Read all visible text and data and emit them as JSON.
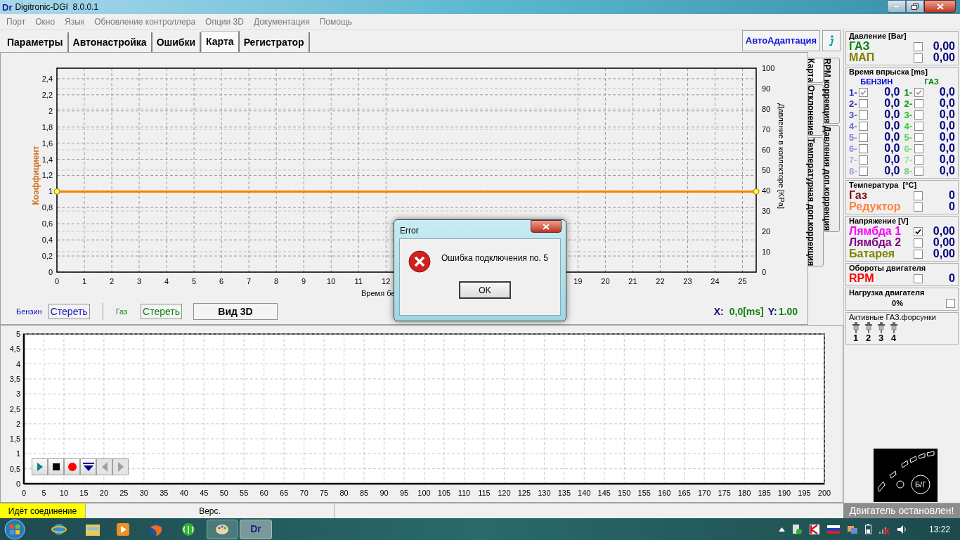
{
  "window": {
    "logo": "Dr",
    "title": "Digitronic-DGI  8.0.0.1"
  },
  "menu": [
    "Порт",
    "Окно",
    "Язык",
    "Обновление контроллера",
    "Опции 3D",
    "Документация",
    "Помощь"
  ],
  "tabs": [
    {
      "label": "Параметры",
      "selected": false
    },
    {
      "label": "Автонастройка",
      "selected": false
    },
    {
      "label": "Ошибки",
      "selected": false
    },
    {
      "label": "Карта",
      "selected": true
    },
    {
      "label": "Регистратор",
      "selected": false
    }
  ],
  "autoadapt_button": "АвтоАдаптация",
  "map": {
    "chart_data": {
      "type": "line",
      "xlabel": "Время бе",
      "ylabel": "Коэффициент",
      "x": [
        0,
        25.5
      ],
      "grid": true,
      "series": [
        {
          "color": "#ff8000",
          "marker": "circle",
          "values": [
            1,
            1
          ]
        }
      ],
      "xlim": [
        0,
        25.5
      ],
      "ylim": [
        0,
        2.53
      ],
      "xticks": [
        0,
        1,
        2,
        3,
        4,
        5,
        6,
        7,
        8,
        9,
        10,
        11,
        12,
        19,
        20,
        21,
        22,
        23,
        24,
        25
      ],
      "yticks": [
        {
          "value": 0,
          "label": "0"
        },
        {
          "value": 0.2,
          "label": "0,2"
        },
        {
          "value": 0.4,
          "label": "0,4"
        },
        {
          "value": 0.6,
          "label": "0,6"
        },
        {
          "value": 0.8,
          "label": "0,8"
        },
        {
          "value": 1,
          "label": "1"
        },
        {
          "value": 1.2,
          "label": "1,2"
        },
        {
          "value": 1.4,
          "label": "1,4"
        },
        {
          "value": 1.6,
          "label": "1,6"
        },
        {
          "value": 1.8,
          "label": "1,8"
        },
        {
          "value": 2,
          "label": "2"
        },
        {
          "value": 2.2,
          "label": "2,2"
        },
        {
          "value": 2.4,
          "label": "2,4"
        }
      ]
    },
    "right_axis": {
      "label": "Давление в коллекторе [KPa]",
      "ticks": [
        "100",
        "90",
        "80",
        "70",
        "60",
        "50",
        "40",
        "30",
        "20",
        "10",
        "0"
      ]
    }
  },
  "side_tabs": {
    "front": [
      {
        "label": "Карта",
        "selected": true
      },
      {
        "label": "Отклонение",
        "selected": false
      },
      {
        "label": "Температурная доп.коррекция",
        "selected": false
      }
    ],
    "back": [
      {
        "label": "RPM коррекция",
        "selected": false
      },
      {
        "label": "Давления доп.коррекция",
        "selected": false
      }
    ]
  },
  "map_controls": {
    "petrol_label": "Бензин",
    "petrol_clear": "Стереть",
    "gas_label": "Газ",
    "gas_clear": "Стереть",
    "view3d": "Вид 3D",
    "x_label": "X:",
    "x_value": "0,0[ms]",
    "y_label": "Y:",
    "y_value": "1.00"
  },
  "recorder": {
    "chart_data": {
      "type": "line",
      "grid": true,
      "xlim": [
        0,
        200
      ],
      "ylim": [
        0,
        5
      ],
      "xticks": [
        0,
        5,
        10,
        15,
        20,
        25,
        30,
        35,
        40,
        45,
        50,
        55,
        60,
        65,
        70,
        75,
        80,
        85,
        90,
        95,
        100,
        105,
        110,
        115,
        120,
        125,
        130,
        135,
        140,
        145,
        150,
        155,
        160,
        165,
        170,
        175,
        180,
        185,
        190,
        195,
        200
      ],
      "yticks": [
        {
          "value": 0,
          "label": "0"
        },
        {
          "value": 0.5,
          "label": "0,5"
        },
        {
          "value": 1,
          "label": "1"
        },
        {
          "value": 1.5,
          "label": "1,5"
        },
        {
          "value": 2,
          "label": "2"
        },
        {
          "value": 2.5,
          "label": "2,5"
        },
        {
          "value": 3,
          "label": "3"
        },
        {
          "value": 3.5,
          "label": "3,5"
        },
        {
          "value": 4,
          "label": "4"
        },
        {
          "value": 4.5,
          "label": "4,5"
        },
        {
          "value": 5,
          "label": "5"
        }
      ]
    },
    "toolbar": [
      {
        "kind": "play",
        "disabled": false
      },
      {
        "kind": "stop",
        "disabled": false
      },
      {
        "kind": "record",
        "disabled": false
      },
      {
        "kind": "down",
        "disabled": false
      },
      {
        "kind": "back",
        "disabled": true
      },
      {
        "kind": "forward",
        "disabled": true
      }
    ]
  },
  "panels": [
    {
      "kind": "rows",
      "title": "Давление [Bar]",
      "rows": [
        {
          "label": "ГАЗ",
          "color": "#108010",
          "checked": false,
          "value": "0,00"
        },
        {
          "label": "МАП",
          "color": "#808000",
          "checked": false,
          "value": "0,00"
        }
      ]
    },
    {
      "kind": "injection",
      "title": "Время впрыска [ms]",
      "columns": [
        {
          "heading": "БЕНЗИН",
          "color": "#0000e0",
          "rows": [
            {
              "label": "1-",
              "color": "#2020c0",
              "checked": true,
              "value": "0,0"
            },
            {
              "label": "2-",
              "color": "#3030c0",
              "checked": false,
              "value": "0,0"
            },
            {
              "label": "3-",
              "color": "#5050c8",
              "checked": false,
              "value": "0,0"
            },
            {
              "label": "4-",
              "color": "#6a6ad0",
              "checked": false,
              "value": "0,0"
            },
            {
              "label": "5-",
              "color": "#8080d8",
              "checked": false,
              "value": "0,0"
            },
            {
              "label": "6-",
              "color": "#9090e0",
              "checked": false,
              "value": "0,0"
            },
            {
              "label": "7-",
              "color": "#b0b0e8",
              "checked": false,
              "value": "0,0"
            },
            {
              "label": "8-",
              "color": "#9c9ce0",
              "checked": false,
              "value": "0,0"
            }
          ]
        },
        {
          "heading": "ГАЗ",
          "color": "#008000",
          "rows": [
            {
              "label": "1-",
              "color": "#008000",
              "checked": true,
              "value": "0,0"
            },
            {
              "label": "2-",
              "color": "#00a000",
              "checked": false,
              "value": "0,0"
            },
            {
              "label": "3-",
              "color": "#20c020",
              "checked": false,
              "value": "0,0"
            },
            {
              "label": "4-",
              "color": "#30d030",
              "checked": false,
              "value": "0,0"
            },
            {
              "label": "5-",
              "color": "#50d850",
              "checked": false,
              "value": "0,0"
            },
            {
              "label": "6-",
              "color": "#70e070",
              "checked": false,
              "value": "0,0"
            },
            {
              "label": "7-",
              "color": "#90e890",
              "checked": false,
              "value": "0,0"
            },
            {
              "label": "8-",
              "color": "#78cc78",
              "checked": false,
              "value": "0,0"
            }
          ]
        }
      ]
    },
    {
      "kind": "rows",
      "title": "Температура  [°C]",
      "rows": [
        {
          "label": "Газ",
          "color": "#800000",
          "checked": false,
          "value": "0"
        },
        {
          "label": "Редуктор",
          "color": "#ff8040",
          "checked": false,
          "value": "0"
        }
      ]
    },
    {
      "kind": "rows",
      "title": "Напряжение [V]",
      "rows": [
        {
          "label": "Лямбда 1",
          "color": "#ff00ff",
          "checked": true,
          "value": "0,00"
        },
        {
          "label": "Лямбда 2",
          "color": "#800080",
          "checked": false,
          "value": "0,00"
        },
        {
          "label": "Батарея",
          "color": "#808000",
          "checked": false,
          "value": "0,00"
        }
      ]
    },
    {
      "kind": "rows",
      "title": "Обороты двигателя",
      "rows": [
        {
          "label": "RPM",
          "color": "#ff0000",
          "checked": false,
          "value": "0"
        }
      ]
    },
    {
      "kind": "load",
      "title": "Нагрузка двигателя",
      "value": "0%",
      "checked": false
    },
    {
      "kind": "injectors",
      "title": "Активные ГАЗ.форсунки",
      "injectors": [
        "1",
        "2",
        "3",
        "4"
      ]
    }
  ],
  "indicator": {
    "label": "Б/Г"
  },
  "dialog": {
    "title": "Error",
    "message": "Ошибка подключения no. 5",
    "button": "OK"
  },
  "status_bar": {
    "connection": "Идёт соединение",
    "version": "Верс.",
    "engine": "Двигатель остановлен!"
  },
  "taskbar": {
    "app_logo": "Dr",
    "time": "13:22"
  }
}
